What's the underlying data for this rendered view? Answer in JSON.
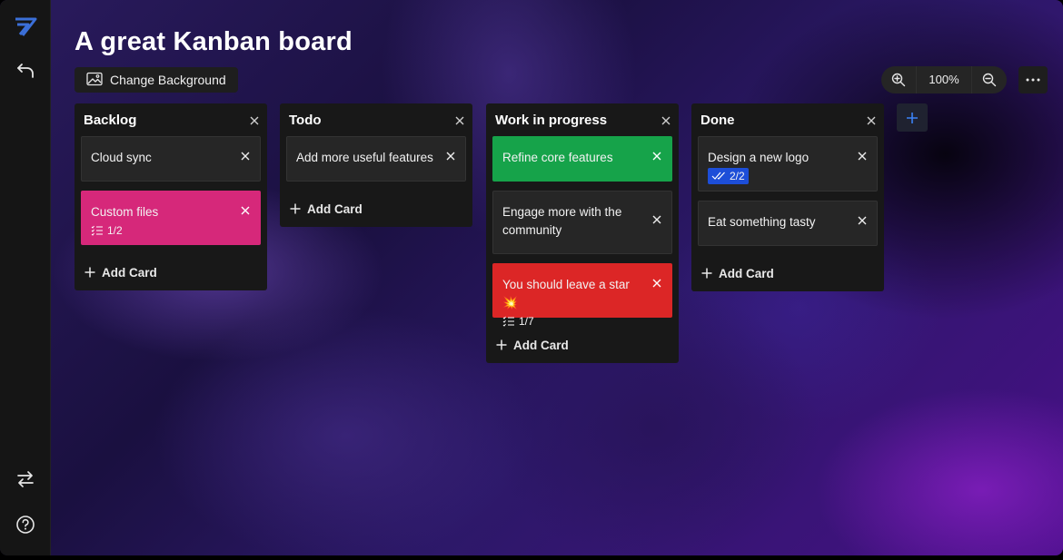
{
  "board": {
    "title": "A great Kanban board",
    "change_background_label": "Change Background"
  },
  "toolbar": {
    "zoom_level": "100%"
  },
  "columns": [
    {
      "title": "Backlog",
      "cards": [
        {
          "text": "Cloud sync",
          "color": "",
          "checklist": ""
        },
        {
          "text": "Custom files",
          "color": "#d6287a",
          "checklist": "1/2"
        }
      ],
      "add_card_label": "Add Card"
    },
    {
      "title": "Todo",
      "cards": [
        {
          "text": "Add more useful features",
          "color": "",
          "checklist": ""
        }
      ],
      "add_card_label": "Add Card"
    },
    {
      "title": "Work in progress",
      "cards": [
        {
          "text": "Refine core features",
          "color": "#16a34a",
          "checklist": ""
        },
        {
          "text": "Engage more with the community",
          "color": "",
          "checklist": ""
        },
        {
          "text": "You should leave a star 💥",
          "color": "#dc2626",
          "checklist": "1/7"
        }
      ],
      "add_card_label": "Add Card"
    },
    {
      "title": "Done",
      "cards": [
        {
          "text": "Design a new logo",
          "color": "",
          "checklist": "2/2",
          "checklist_complete": true
        },
        {
          "text": "Eat something tasty",
          "color": "",
          "checklist": ""
        }
      ],
      "add_card_label": "Add Card"
    }
  ],
  "icons": {
    "logo": "app-logo-icon",
    "back": "undo-arrow-icon",
    "switch": "swap-arrows-icon",
    "help": "help-circle-icon",
    "background": "image-icon",
    "zoom_in": "zoom-in-icon",
    "zoom_out": "zoom-out-icon",
    "more": "more-dots-icon",
    "add_column": "plus-icon",
    "close": "close-icon",
    "checklist": "checklist-icon",
    "checklist_done": "double-check-icon"
  },
  "colors": {
    "accent": "#3b82f6",
    "sidebar": "#151515",
    "column": "#181818",
    "card": "#262626"
  }
}
